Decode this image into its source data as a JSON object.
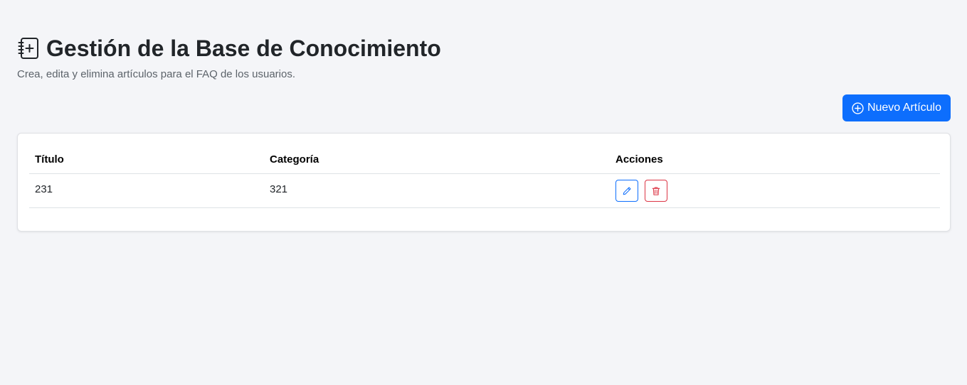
{
  "header": {
    "title": "Gestión de la Base de Conocimiento",
    "subtitle": "Crea, edita y elimina artículos para el FAQ de los usuarios.",
    "icon": "journal-plus-icon"
  },
  "toolbar": {
    "new_article_label": "Nuevo Artículo",
    "new_article_icon": "plus-circle-icon"
  },
  "table": {
    "columns": [
      "Título",
      "Categoría",
      "Acciones"
    ],
    "rows": [
      {
        "title": "231",
        "category": "321"
      }
    ],
    "actions": {
      "edit_icon": "pencil-icon",
      "delete_icon": "trash-icon"
    }
  },
  "colors": {
    "primary": "#0d6efd",
    "danger": "#dc3545",
    "background": "#f4f5f8"
  }
}
